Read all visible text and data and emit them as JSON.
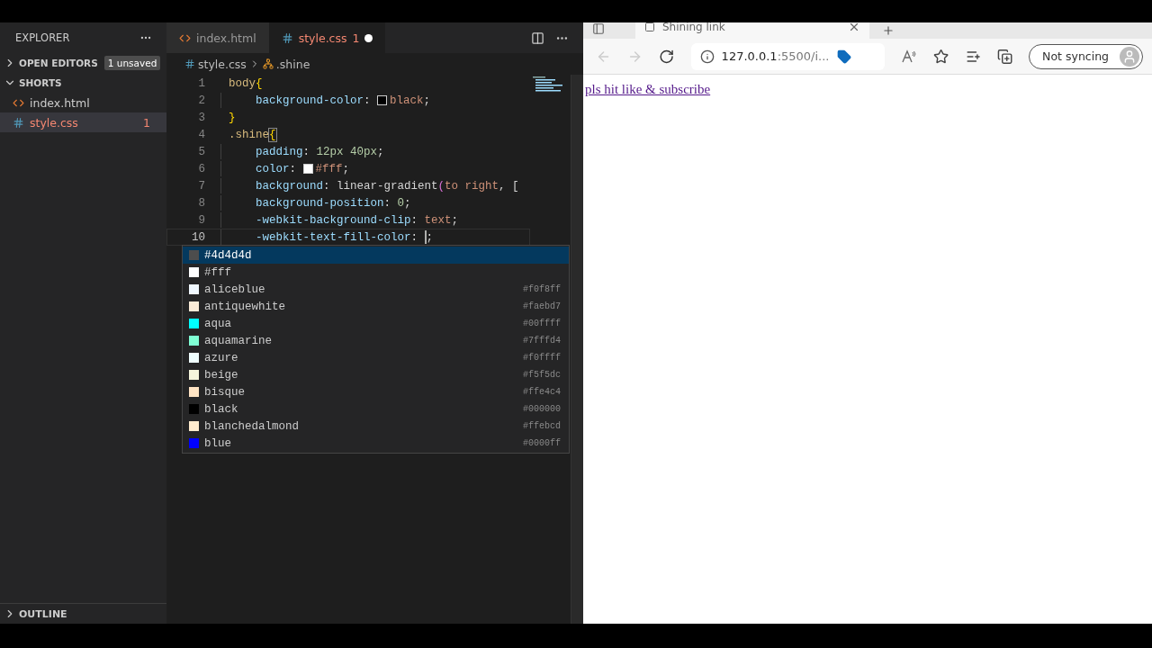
{
  "sidebar": {
    "title": "EXPLORER",
    "sections": [
      {
        "label": "OPEN EDITORS",
        "expanded": false,
        "badge": "1 unsaved"
      },
      {
        "label": "SHORTS",
        "expanded": true,
        "files": [
          {
            "name": "index.html",
            "kind": "html",
            "selected": false,
            "modified": false
          },
          {
            "name": "style.css",
            "kind": "css",
            "selected": true,
            "modified": true,
            "problems": "1"
          }
        ]
      }
    ],
    "outline": {
      "label": "OUTLINE",
      "expanded": false
    }
  },
  "editor_tabs": [
    {
      "name": "index.html",
      "kind": "html",
      "selected": false,
      "modified": false
    },
    {
      "name": "style.css",
      "kind": "css",
      "selected": true,
      "modified": true,
      "problems": "1"
    }
  ],
  "breadcrumb": {
    "file": "style.css",
    "symbol": ".shine"
  },
  "code_lines": [
    {
      "number": "1",
      "active": false,
      "indented": false,
      "tokens": [
        {
          "kind": "selector",
          "text": "body"
        },
        {
          "kind": "brace",
          "text": "{"
        }
      ]
    },
    {
      "number": "2",
      "active": false,
      "indented": true,
      "tokens": [
        {
          "kind": "property",
          "text": "background-color"
        },
        {
          "kind": "punct",
          "text": ": "
        },
        {
          "kind": "swatch",
          "color": "#000000"
        },
        {
          "kind": "value",
          "text": "black"
        },
        {
          "kind": "punct",
          "text": ";"
        }
      ]
    },
    {
      "number": "3",
      "active": false,
      "indented": false,
      "tokens": [
        {
          "kind": "brace",
          "text": "}"
        }
      ]
    },
    {
      "number": "4",
      "active": false,
      "indented": false,
      "tokens": [
        {
          "kind": "selector",
          "text": ".shine"
        },
        {
          "kind": "brace-match",
          "text": "{"
        }
      ]
    },
    {
      "number": "5",
      "active": false,
      "indented": true,
      "tokens": [
        {
          "kind": "property",
          "text": "padding"
        },
        {
          "kind": "punct",
          "text": ": "
        },
        {
          "kind": "number",
          "text": "12px 40px"
        },
        {
          "kind": "punct",
          "text": ";"
        }
      ]
    },
    {
      "number": "6",
      "active": false,
      "indented": true,
      "tokens": [
        {
          "kind": "property",
          "text": "color"
        },
        {
          "kind": "punct",
          "text": ": "
        },
        {
          "kind": "swatch",
          "color": "#ffffff"
        },
        {
          "kind": "value",
          "text": "#fff"
        },
        {
          "kind": "punct",
          "text": ";"
        }
      ]
    },
    {
      "number": "7",
      "active": false,
      "indented": true,
      "tokens": [
        {
          "kind": "property",
          "text": "background"
        },
        {
          "kind": "punct",
          "text": ": "
        },
        {
          "kind": "punct",
          "text": "linear-gradient"
        },
        {
          "kind": "paren",
          "text": "("
        },
        {
          "kind": "value",
          "text": "to right"
        },
        {
          "kind": "punct",
          "text": ", ["
        }
      ]
    },
    {
      "number": "8",
      "active": false,
      "indented": true,
      "tokens": [
        {
          "kind": "property",
          "text": "background-position"
        },
        {
          "kind": "punct",
          "text": ": "
        },
        {
          "kind": "number",
          "text": "0"
        },
        {
          "kind": "punct",
          "text": ";"
        }
      ]
    },
    {
      "number": "9",
      "active": false,
      "indented": true,
      "tokens": [
        {
          "kind": "property",
          "text": "-webkit-background-clip"
        },
        {
          "kind": "punct",
          "text": ": "
        },
        {
          "kind": "value",
          "text": "text"
        },
        {
          "kind": "punct",
          "text": ";"
        }
      ]
    },
    {
      "number": "10",
      "active": true,
      "indented": true,
      "tokens": [
        {
          "kind": "property",
          "text": "-webkit-text-fill-color"
        },
        {
          "kind": "punct",
          "text": ": "
        },
        {
          "kind": "caret"
        },
        {
          "kind": "punct",
          "text": ";"
        }
      ]
    }
  ],
  "suggestions": [
    {
      "label": "#4d4d4d",
      "color": "#4d4d4d",
      "selected": true
    },
    {
      "label": "#fff",
      "color": "#ffffff",
      "selected": false
    },
    {
      "label": "aliceblue",
      "detail": "#f0f8ff",
      "color": "#f0f8ff",
      "selected": false
    },
    {
      "label": "antiquewhite",
      "detail": "#faebd7",
      "color": "#faebd7",
      "selected": false
    },
    {
      "label": "aqua",
      "detail": "#00ffff",
      "color": "#00ffff",
      "selected": false
    },
    {
      "label": "aquamarine",
      "detail": "#7fffd4",
      "color": "#7fffd4",
      "selected": false
    },
    {
      "label": "azure",
      "detail": "#f0ffff",
      "color": "#f0ffff",
      "selected": false
    },
    {
      "label": "beige",
      "detail": "#f5f5dc",
      "color": "#f5f5dc",
      "selected": false
    },
    {
      "label": "bisque",
      "detail": "#ffe4c4",
      "color": "#ffe4c4",
      "selected": false
    },
    {
      "label": "black",
      "detail": "#000000",
      "color": "#000000",
      "selected": false
    },
    {
      "label": "blanchedalmond",
      "detail": "#ffebcd",
      "color": "#ffebcd",
      "selected": false
    },
    {
      "label": "blue",
      "detail": "#0000ff",
      "color": "#0000ff",
      "selected": false
    }
  ],
  "browser": {
    "tab": {
      "title": "Shining link"
    },
    "address": {
      "host": "127.0.0.1",
      "path": ":5500/i..."
    },
    "profile": {
      "label": "Not syncing"
    },
    "page": {
      "link": "pls hit like & subscribe"
    }
  }
}
